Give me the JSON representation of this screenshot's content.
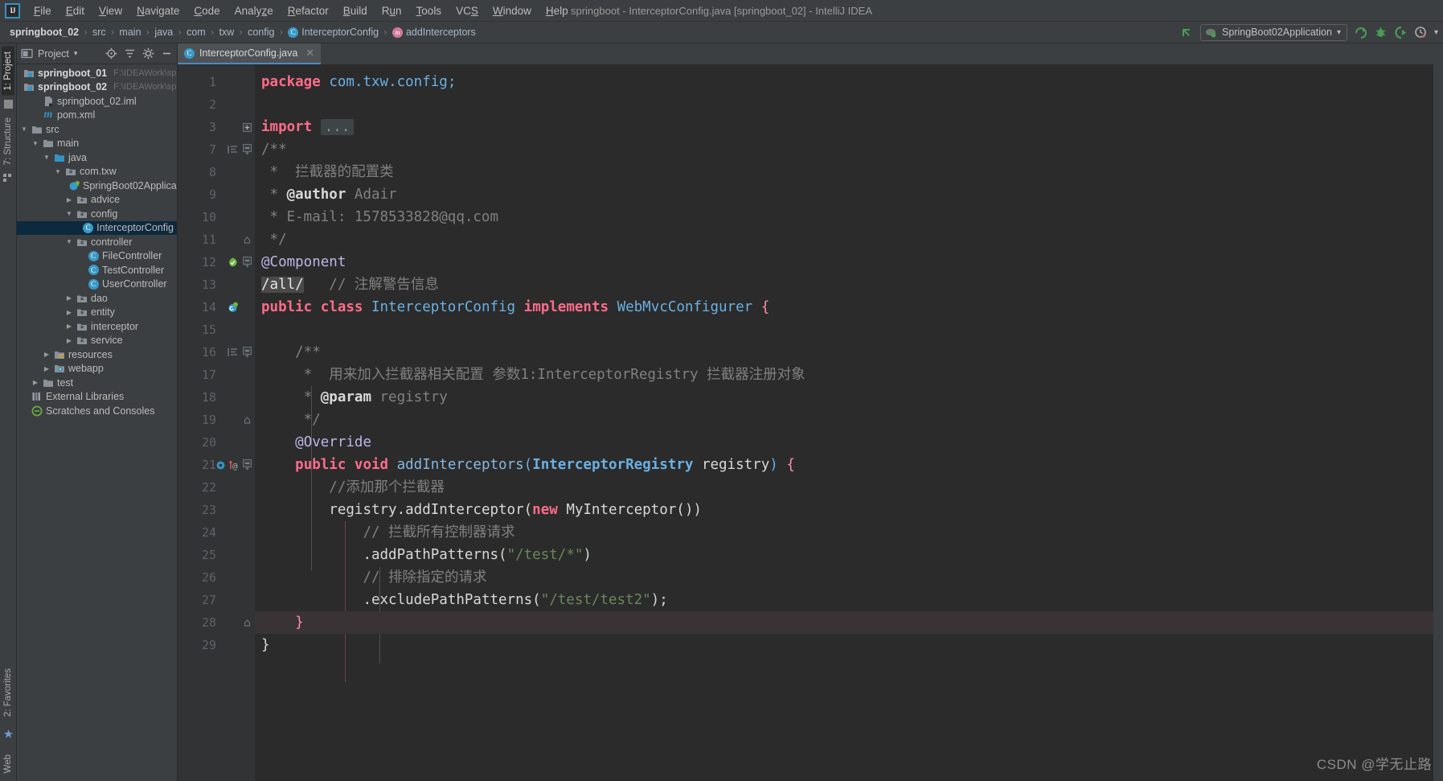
{
  "window": {
    "title": "springboot - InterceptorConfig.java [springboot_02] - IntelliJ IDEA",
    "logo": "ij-logo"
  },
  "menubar": {
    "items": [
      {
        "label": "File",
        "mnemonic": "F"
      },
      {
        "label": "Edit",
        "mnemonic": "E"
      },
      {
        "label": "View",
        "mnemonic": "V"
      },
      {
        "label": "Navigate",
        "mnemonic": "N"
      },
      {
        "label": "Code",
        "mnemonic": "C"
      },
      {
        "label": "Analyze",
        "mnemonic": "z"
      },
      {
        "label": "Refactor",
        "mnemonic": "R"
      },
      {
        "label": "Build",
        "mnemonic": "B"
      },
      {
        "label": "Run",
        "mnemonic": "u"
      },
      {
        "label": "Tools",
        "mnemonic": "T"
      },
      {
        "label": "VCS",
        "mnemonic": "S"
      },
      {
        "label": "Window",
        "mnemonic": "W"
      },
      {
        "label": "Help",
        "mnemonic": "H"
      }
    ]
  },
  "navbar": {
    "breadcrumbs": [
      {
        "label": "springboot_02",
        "kind": "project"
      },
      {
        "label": "src",
        "kind": "folder"
      },
      {
        "label": "main",
        "kind": "folder"
      },
      {
        "label": "java",
        "kind": "folder"
      },
      {
        "label": "com",
        "kind": "folder"
      },
      {
        "label": "txw",
        "kind": "folder"
      },
      {
        "label": "config",
        "kind": "folder"
      },
      {
        "label": "InterceptorConfig",
        "kind": "class"
      },
      {
        "label": "addInterceptors",
        "kind": "method"
      }
    ],
    "separator": "›",
    "run_config": {
      "label": "SpringBoot02Application",
      "dropdown_glyph": "▾",
      "icon": "springboot-run-icon"
    },
    "actions": [
      {
        "name": "back-arrow-icon"
      },
      {
        "name": "run-icon"
      },
      {
        "name": "debug-icon"
      },
      {
        "name": "run-with-coverage-icon"
      },
      {
        "name": "profiler-icon"
      },
      {
        "name": "more-chevron-icon"
      }
    ]
  },
  "left_strip": {
    "tabs": [
      {
        "label": "1: Project",
        "active": true
      },
      {
        "label": "7: Structure",
        "active": false
      }
    ],
    "bottom_tabs": [
      {
        "label": "2: Favorites"
      },
      {
        "label": "Web"
      }
    ]
  },
  "project_panel": {
    "title": "Project",
    "dropdown_glyph": "▾",
    "header_icons": [
      "locate-icon",
      "collapse-all-icon",
      "settings-gear-icon",
      "hide-icon"
    ],
    "tree": [
      {
        "depth": 0,
        "arrow": "none",
        "icon": "module-icon",
        "label": "springboot_01",
        "path": "F:\\IDEAWork\\springb",
        "bold": true,
        "selected": false
      },
      {
        "depth": 0,
        "arrow": "none",
        "icon": "module-icon",
        "label": "springboot_02",
        "path": "F:\\IDEAWork\\springb",
        "bold": true,
        "selected": false
      },
      {
        "depth": 1,
        "arrow": "none",
        "icon": "iml-icon",
        "label": "springboot_02.iml",
        "path": "",
        "bold": false,
        "selected": false
      },
      {
        "depth": 1,
        "arrow": "none",
        "icon": "maven-icon",
        "label": "pom.xml",
        "path": "",
        "bold": false,
        "selected": false
      },
      {
        "depth": 0,
        "arrow": "open",
        "icon": "folder-icon",
        "label": "src",
        "path": "",
        "bold": false,
        "selected": false
      },
      {
        "depth": 1,
        "arrow": "open",
        "icon": "folder-icon",
        "label": "main",
        "path": "",
        "bold": false,
        "selected": false
      },
      {
        "depth": 2,
        "arrow": "open",
        "icon": "source-root-icon",
        "label": "java",
        "path": "",
        "bold": false,
        "selected": false
      },
      {
        "depth": 3,
        "arrow": "open",
        "icon": "package-icon",
        "label": "com.txw",
        "path": "",
        "bold": false,
        "selected": false
      },
      {
        "depth": 4,
        "arrow": "none",
        "icon": "spring-class-icon",
        "label": "SpringBoot02Applica",
        "path": "",
        "bold": false,
        "selected": false
      },
      {
        "depth": 4,
        "arrow": "closed",
        "icon": "package-icon",
        "label": "advice",
        "path": "",
        "bold": false,
        "selected": false
      },
      {
        "depth": 4,
        "arrow": "open",
        "icon": "package-icon",
        "label": "config",
        "path": "",
        "bold": false,
        "selected": false
      },
      {
        "depth": 5,
        "arrow": "none",
        "icon": "class-icon",
        "label": "InterceptorConfig",
        "path": "",
        "bold": false,
        "selected": true
      },
      {
        "depth": 4,
        "arrow": "open",
        "icon": "package-icon",
        "label": "controller",
        "path": "",
        "bold": false,
        "selected": false
      },
      {
        "depth": 5,
        "arrow": "none",
        "icon": "class-icon",
        "label": "FileController",
        "path": "",
        "bold": false,
        "selected": false
      },
      {
        "depth": 5,
        "arrow": "none",
        "icon": "class-icon",
        "label": "TestController",
        "path": "",
        "bold": false,
        "selected": false
      },
      {
        "depth": 5,
        "arrow": "none",
        "icon": "class-icon",
        "label": "UserController",
        "path": "",
        "bold": false,
        "selected": false
      },
      {
        "depth": 4,
        "arrow": "closed",
        "icon": "package-icon",
        "label": "dao",
        "path": "",
        "bold": false,
        "selected": false
      },
      {
        "depth": 4,
        "arrow": "closed",
        "icon": "package-icon",
        "label": "entity",
        "path": "",
        "bold": false,
        "selected": false
      },
      {
        "depth": 4,
        "arrow": "closed",
        "icon": "package-icon",
        "label": "interceptor",
        "path": "",
        "bold": false,
        "selected": false
      },
      {
        "depth": 4,
        "arrow": "closed",
        "icon": "package-icon",
        "label": "service",
        "path": "",
        "bold": false,
        "selected": false
      },
      {
        "depth": 2,
        "arrow": "closed",
        "icon": "resources-icon",
        "label": "resources",
        "path": "",
        "bold": false,
        "selected": false
      },
      {
        "depth": 2,
        "arrow": "closed",
        "icon": "webapp-icon",
        "label": "webapp",
        "path": "",
        "bold": false,
        "selected": false
      },
      {
        "depth": 1,
        "arrow": "closed",
        "icon": "folder-icon",
        "label": "test",
        "path": "",
        "bold": false,
        "selected": false
      },
      {
        "depth": 0,
        "arrow": "none",
        "icon": "libraries-icon",
        "label": "External Libraries",
        "path": "",
        "bold": false,
        "selected": false
      },
      {
        "depth": 0,
        "arrow": "none",
        "icon": "scratches-icon",
        "label": "Scratches and Consoles",
        "path": "",
        "bold": false,
        "selected": false
      }
    ]
  },
  "editor": {
    "tabs": [
      {
        "label": "InterceptorConfig.java",
        "icon": "class-icon",
        "close_glyph": "✕",
        "active": true
      }
    ],
    "lines": [
      {
        "num": "1",
        "marks": [],
        "fold": "none"
      },
      {
        "num": "2",
        "marks": [],
        "fold": "none"
      },
      {
        "num": "3",
        "marks": [],
        "fold": "plus"
      },
      {
        "num": "7",
        "marks": [
          "doc-comment-icon"
        ],
        "fold": "minus"
      },
      {
        "num": "8",
        "marks": [],
        "fold": "none"
      },
      {
        "num": "9",
        "marks": [],
        "fold": "none"
      },
      {
        "num": "10",
        "marks": [],
        "fold": "none"
      },
      {
        "num": "11",
        "marks": [],
        "fold": "end"
      },
      {
        "num": "12",
        "marks": [
          "spring-bean-icon"
        ],
        "fold": "minus"
      },
      {
        "num": "13",
        "marks": [],
        "fold": "none"
      },
      {
        "num": "14",
        "marks": [
          "spring-class-icon"
        ],
        "fold": "none"
      },
      {
        "num": "15",
        "marks": [],
        "fold": "none"
      },
      {
        "num": "16",
        "marks": [
          "doc-comment-icon"
        ],
        "fold": "minus"
      },
      {
        "num": "17",
        "marks": [],
        "fold": "none"
      },
      {
        "num": "18",
        "marks": [],
        "fold": "none"
      },
      {
        "num": "19",
        "marks": [],
        "fold": "end"
      },
      {
        "num": "20",
        "marks": [],
        "fold": "none"
      },
      {
        "num": "21",
        "marks": [
          "override-icon",
          "annotation-icon"
        ],
        "fold": "minus"
      },
      {
        "num": "22",
        "marks": [],
        "fold": "none"
      },
      {
        "num": "23",
        "marks": [],
        "fold": "none"
      },
      {
        "num": "24",
        "marks": [],
        "fold": "none"
      },
      {
        "num": "25",
        "marks": [],
        "fold": "none"
      },
      {
        "num": "26",
        "marks": [],
        "fold": "none"
      },
      {
        "num": "27",
        "marks": [],
        "fold": "none"
      },
      {
        "num": "28",
        "marks": [],
        "fold": "end"
      },
      {
        "num": "29",
        "marks": [],
        "fold": "none"
      }
    ],
    "code_text": {
      "l1": "package com.txw.config;",
      "l3": "import ...",
      "l7": "/**",
      "l8": " *  拦截器的配置类",
      "l9": " * @author Adair",
      "l10": " * E-mail: 1578533828@qq.com",
      "l11": " */",
      "l12": "@Component",
      "l13": "/all/   // 注解警告信息",
      "l14": "public class InterceptorConfig implements WebMvcConfigurer {",
      "l16": "/**",
      "l17": " *  用来加入拦截器相关配置 参数1:InterceptorRegistry 拦截器注册对象",
      "l18": " * @param registry",
      "l19": " */",
      "l20": "@Override",
      "l21": "public void addInterceptors(InterceptorRegistry registry) {",
      "l22": "//添加那个拦截器",
      "l23": "registry.addInterceptor(new MyInterceptor())",
      "l24": "// 拦截所有控制器请求",
      "l25": ".addPathPatterns(\"/test/*\")",
      "l26": "// 排除指定的请求",
      "l27": ".excludePathPatterns(\"/test/test2\");",
      "l28": "}",
      "l29": "}"
    }
  },
  "watermark": {
    "text": "CSDN @学无止路"
  },
  "colors": {
    "accent_blue": "#4a88c7",
    "selection_blue": "#0d293e",
    "editor_bg": "#2b2b2b",
    "panel_bg": "#3c3f41",
    "keyword_orange": "#cc7832",
    "keyword_pink": "#ff6b8a",
    "string_green": "#6a8759",
    "comment_gray": "#808080",
    "type_blue": "#6ab0e3",
    "annotation_purple": "#bbb5e7"
  }
}
